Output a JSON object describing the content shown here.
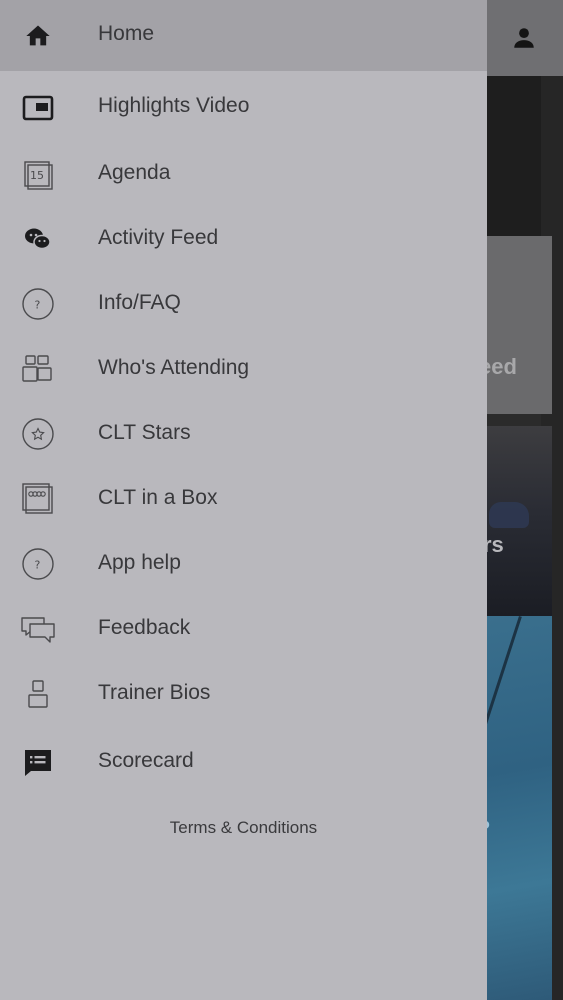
{
  "menu": {
    "items": [
      {
        "label": "Home",
        "icon": "home-icon"
      },
      {
        "label": "Highlights Video",
        "icon": "video-icon"
      },
      {
        "label": "Agenda",
        "icon": "calendar-icon"
      },
      {
        "label": "Activity Feed",
        "icon": "chat-bubbles-icon"
      },
      {
        "label": "Info/FAQ",
        "icon": "question-circle-icon"
      },
      {
        "label": "Who's Attending",
        "icon": "people-icon"
      },
      {
        "label": "CLT Stars",
        "icon": "star-circle-icon"
      },
      {
        "label": "CLT in a Box",
        "icon": "box-icon"
      },
      {
        "label": "App help",
        "icon": "question-circle-icon"
      },
      {
        "label": "Feedback",
        "icon": "feedback-icon"
      },
      {
        "label": "Trainer Bios",
        "icon": "person-outline-icon"
      },
      {
        "label": "Scorecard",
        "icon": "scorecard-icon"
      }
    ],
    "terms_label": "Terms & Conditions"
  },
  "background": {
    "card_1_fragment": "eed",
    "card_2_fragment": "rs",
    "card_3_fragment": "?"
  },
  "colors": {
    "drawer_bg": "#b9b8bd",
    "active_item_bg": "#a3a2a7",
    "text": "#38383b"
  }
}
